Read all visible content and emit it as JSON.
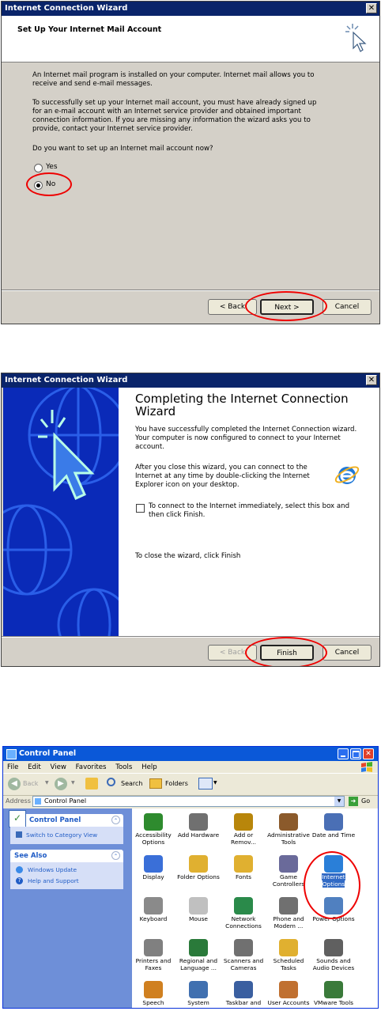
{
  "wizard1": {
    "title": "Internet Connection Wizard",
    "close_glyph": "✕",
    "heading": "Set Up Your Internet Mail Account",
    "p1": "An Internet mail program is installed on your computer. Internet mail allows you to receive and send e-mail messages.",
    "p2": "To successfully set up your Internet mail account, you must have already signed up for an e-mail account with an Internet service provider and obtained important connection information. If you are missing any information the wizard asks you to provide, contact your Internet service provider.",
    "question": "Do you want to set up an Internet mail account now?",
    "opt_yes": "Yes",
    "opt_no": "No",
    "selected": "No",
    "back": "< Back",
    "next": "Next >",
    "cancel": "Cancel"
  },
  "wizard2": {
    "title": "Internet Connection Wizard",
    "close_glyph": "✕",
    "heading": "Completing the Internet Connection Wizard",
    "p1": "You have successfully completed the Internet Connection wizard. Your computer is now configured to connect to your Internet account.",
    "p2": "After you close this wizard, you can connect to the Internet at any time by double-clicking the Internet Explorer icon on your desktop.",
    "checkbox_label": "To connect to the Internet immediately, select this box and then click Finish.",
    "checkbox_checked": false,
    "p3": "To close the wizard, click Finish",
    "back": "< Back",
    "finish": "Finish",
    "cancel": "Cancel"
  },
  "control_panel": {
    "title": "Control Panel",
    "menu": [
      "File",
      "Edit",
      "View",
      "Favorites",
      "Tools",
      "Help"
    ],
    "toolbar": {
      "back": "Back",
      "search": "Search",
      "folders": "Folders"
    },
    "address_label": "Address",
    "address_value": "Control Panel",
    "go": "Go",
    "sidebar": {
      "panel_title": "Control Panel",
      "switch_link": "Switch to Category View",
      "see_also_title": "See Also",
      "links": [
        "Windows Update",
        "Help and Support"
      ]
    },
    "icons": [
      {
        "label": "Accessibility Options",
        "color": "#2e8b2e"
      },
      {
        "label": "Add Hardware",
        "color": "#707070"
      },
      {
        "label": "Add or Remov...",
        "color": "#b8860b"
      },
      {
        "label": "Administrative Tools",
        "color": "#8b5a2b"
      },
      {
        "label": "Date and Time",
        "color": "#4a6fb5"
      },
      {
        "label": "Display",
        "color": "#3a6fd8"
      },
      {
        "label": "Folder Options",
        "color": "#e0b030"
      },
      {
        "label": "Fonts",
        "color": "#e0b030"
      },
      {
        "label": "Game Controllers",
        "color": "#6a6a9a"
      },
      {
        "label": "Internet Options",
        "color": "#2a7fd8"
      },
      {
        "label": "Keyboard",
        "color": "#8a8a8a"
      },
      {
        "label": "Mouse",
        "color": "#c0c0c0"
      },
      {
        "label": "Network Connections",
        "color": "#2a8a4a"
      },
      {
        "label": "Phone and Modem ...",
        "color": "#707070"
      },
      {
        "label": "Power Options",
        "color": "#5080c0"
      },
      {
        "label": "Printers and Faxes",
        "color": "#808080"
      },
      {
        "label": "Regional and Language ...",
        "color": "#2a7a3a"
      },
      {
        "label": "Scanners and Cameras",
        "color": "#707070"
      },
      {
        "label": "Scheduled Tasks",
        "color": "#e0b030"
      },
      {
        "label": "Sounds and Audio Devices",
        "color": "#606060"
      },
      {
        "label": "Speech",
        "color": "#d08020"
      },
      {
        "label": "System",
        "color": "#4070b0"
      },
      {
        "label": "Taskbar and",
        "color": "#3a5fa0"
      },
      {
        "label": "User Accounts",
        "color": "#c07030"
      },
      {
        "label": "VMware Tools",
        "color": "#3a7a3a"
      }
    ],
    "selected_icon": "Internet Options"
  },
  "colors": {
    "highlight_circle": "#e00000",
    "xp_blue": "#0a58d8",
    "classic_title": "#0a246a"
  }
}
